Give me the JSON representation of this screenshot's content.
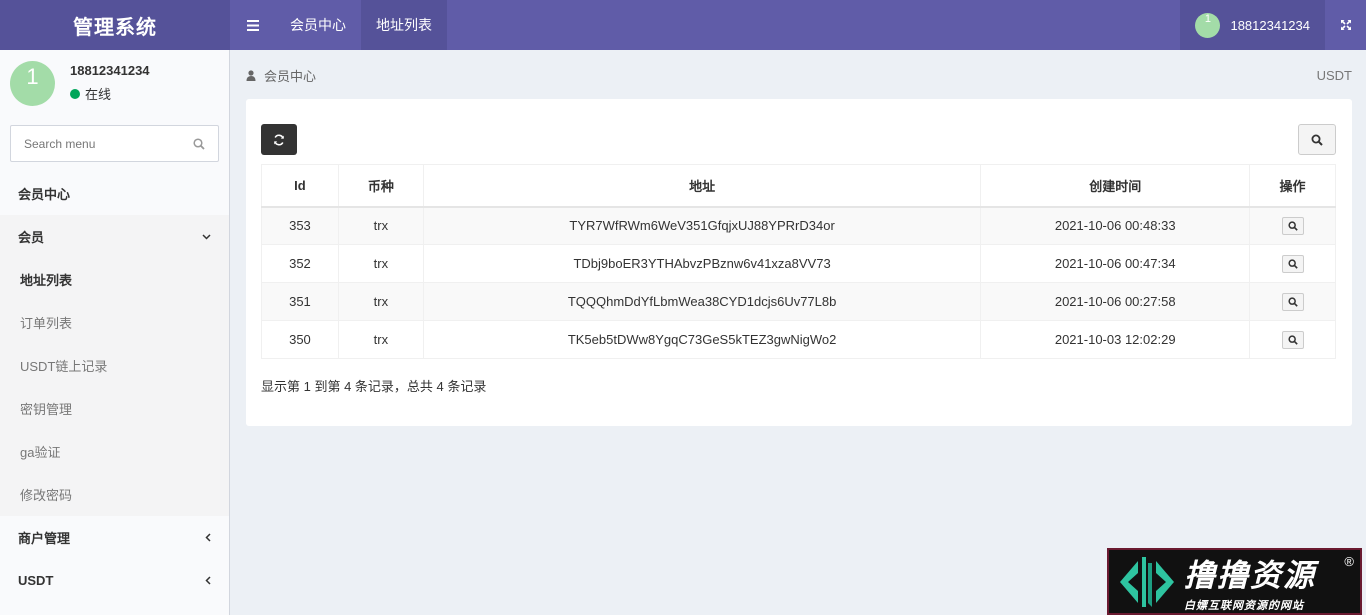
{
  "header": {
    "logo": "管理系统",
    "tabs": [
      {
        "label": "会员中心",
        "active": false
      },
      {
        "label": "地址列表",
        "active": true
      }
    ],
    "user": {
      "avatar_text": "1",
      "name": "18812341234"
    }
  },
  "sidebar": {
    "user": {
      "avatar_text": "1",
      "name": "18812341234",
      "status": "在线"
    },
    "search": {
      "placeholder": "Search menu"
    },
    "menu": [
      {
        "label": "会员中心"
      },
      {
        "label": "会员",
        "expanded": true,
        "children": [
          {
            "label": "地址列表",
            "active": true
          },
          {
            "label": "订单列表"
          },
          {
            "label": "USDT链上记录"
          },
          {
            "label": "密钥管理"
          },
          {
            "label": "ga验证"
          },
          {
            "label": "修改密码"
          }
        ]
      },
      {
        "label": "商户管理",
        "expanded": false
      },
      {
        "label": "USDT",
        "expanded": false
      }
    ]
  },
  "content": {
    "breadcrumb": "会员中心",
    "right_label": "USDT",
    "table": {
      "columns": [
        "Id",
        "币种",
        "地址",
        "创建时间",
        "操作"
      ],
      "rows": [
        {
          "id": "353",
          "coin": "trx",
          "address": "TYR7WfRWm6WeV351GfqjxUJ88YPRrD34or",
          "created": "2021-10-06 00:48:33"
        },
        {
          "id": "352",
          "coin": "trx",
          "address": "TDbj9boER3YTHAbvzPBznw6v41xza8VV73",
          "created": "2021-10-06 00:47:34"
        },
        {
          "id": "351",
          "coin": "trx",
          "address": "TQQQhmDdYfLbmWea38CYD1dcjs6Uv77L8b",
          "created": "2021-10-06 00:27:58"
        },
        {
          "id": "350",
          "coin": "trx",
          "address": "TK5eb5tDWw8YgqC73GeS5kTEZ3gwNigWo2",
          "created": "2021-10-03 12:02:29"
        }
      ]
    },
    "pagination": "显示第 1 到第 4 条记录，总共 4 条记录"
  },
  "watermark": {
    "title": "撸撸资源",
    "subtitle": "白嫖互联网资源的网站",
    "reg": "®"
  },
  "colors": {
    "header": "#605ca8",
    "header_dark": "#555299",
    "avatar": "#a3dca8",
    "online": "#00a65a"
  },
  "icons": {
    "menu_toggle": "bars-icon",
    "fullscreen": "expand-icon",
    "search": "search-icon",
    "refresh": "refresh-icon",
    "user": "user-icon"
  }
}
